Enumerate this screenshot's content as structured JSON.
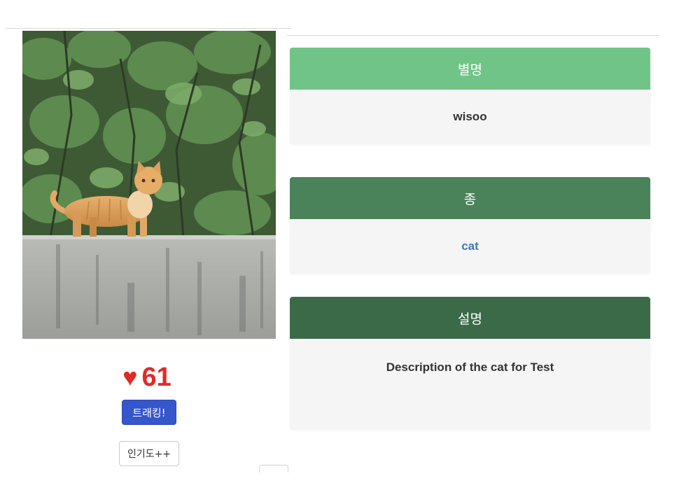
{
  "cat": {
    "likes": "61",
    "track_label": "트래킹!",
    "popularity_label": "인기도++"
  },
  "cards": {
    "nickname": {
      "title": "별명",
      "value": "wisoo"
    },
    "species": {
      "title": "종",
      "value": "cat"
    },
    "description": {
      "title": "설명",
      "value": "Description of the cat for Test"
    }
  },
  "icons": {
    "likes": "heart-icon"
  },
  "colors": {
    "likes": "#e02b27",
    "track_button": "#3656cc",
    "nickname_header": "#70c487",
    "species_header": "#4a825a",
    "description_header": "#3b6a48",
    "species_link": "#4178b0"
  }
}
